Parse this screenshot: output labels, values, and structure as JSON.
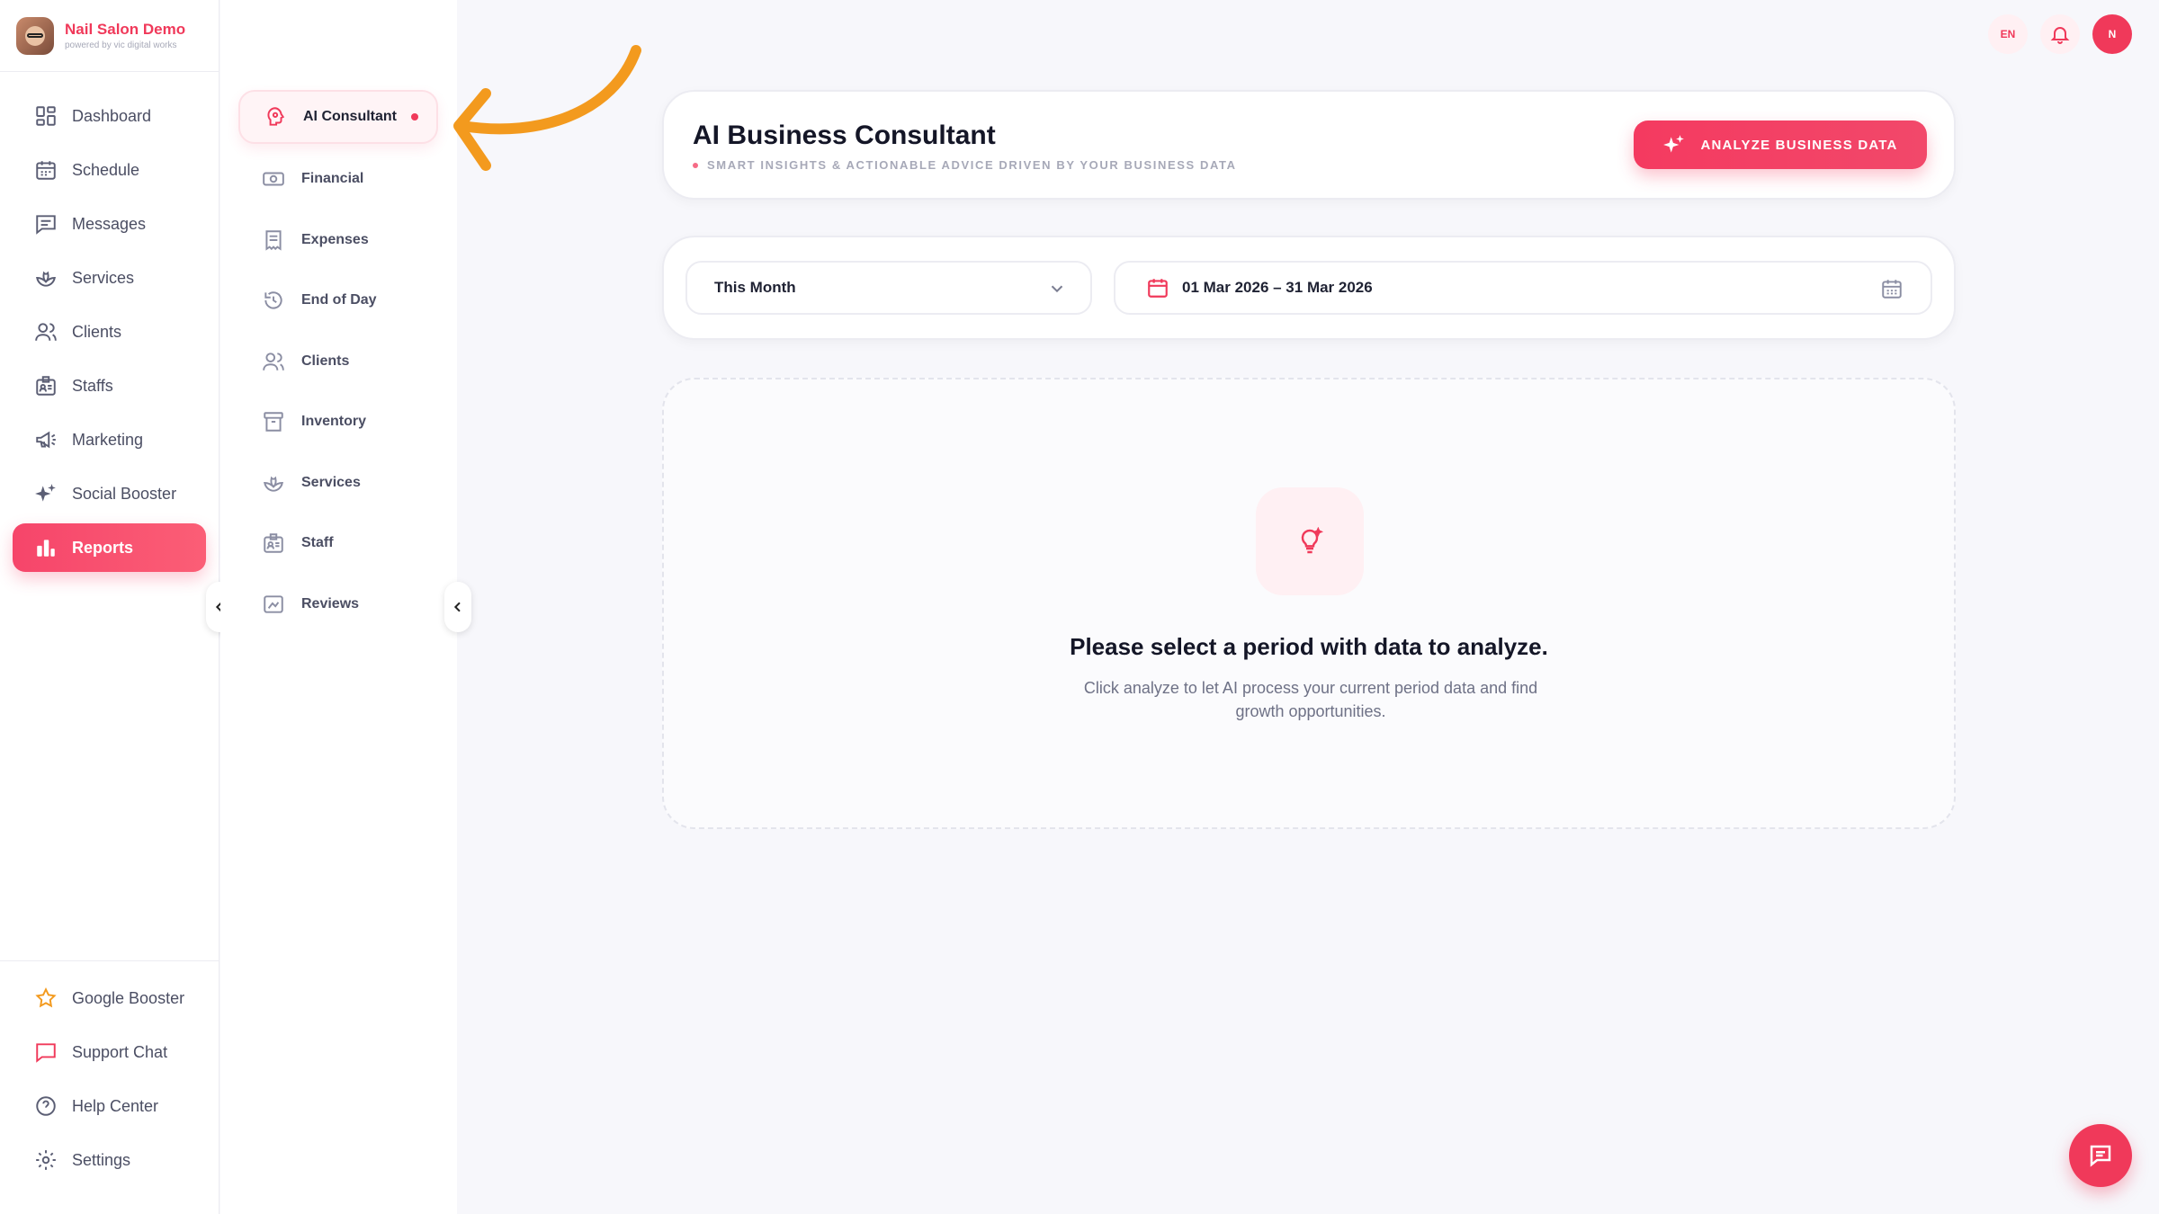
{
  "brand": {
    "name": "Nail Salon Demo",
    "sub": "powered by vic digital works"
  },
  "sidebar": {
    "items": [
      {
        "label": "Dashboard",
        "icon": "dashboard-icon"
      },
      {
        "label": "Schedule",
        "icon": "calendar-icon"
      },
      {
        "label": "Messages",
        "icon": "message-icon"
      },
      {
        "label": "Services",
        "icon": "lotus-icon"
      },
      {
        "label": "Clients",
        "icon": "users-icon"
      },
      {
        "label": "Staffs",
        "icon": "id-badge-icon"
      },
      {
        "label": "Marketing",
        "icon": "megaphone-icon"
      },
      {
        "label": "Social Booster",
        "icon": "sparkles-icon"
      },
      {
        "label": "Reports",
        "icon": "bar-chart-icon",
        "active": true
      }
    ],
    "bottom": [
      {
        "label": "Google Booster",
        "icon": "star-icon"
      },
      {
        "label": "Support Chat",
        "icon": "chat-bubble-icon"
      },
      {
        "label": "Help Center",
        "icon": "help-circle-icon"
      },
      {
        "label": "Settings",
        "icon": "gear-icon"
      }
    ]
  },
  "reports_menu": {
    "items": [
      {
        "label": "AI Consultant",
        "active": true
      },
      {
        "label": "Financial"
      },
      {
        "label": "Expenses"
      },
      {
        "label": "End of Day"
      },
      {
        "label": "Clients"
      },
      {
        "label": "Inventory"
      },
      {
        "label": "Services"
      },
      {
        "label": "Staff"
      },
      {
        "label": "Reviews"
      }
    ]
  },
  "topbar": {
    "language": "EN",
    "user_initial": "N"
  },
  "consultant": {
    "title": "AI Business Consultant",
    "subtitle": "SMART INSIGHTS & ACTIONABLE ADVICE DRIVEN BY YOUR BUSINESS DATA",
    "analyze_label": "ANALYZE BUSINESS DATA"
  },
  "filters": {
    "period": "This Month",
    "date_range": "01 Mar 2026 – 31 Mar 2026"
  },
  "empty_state": {
    "title": "Please select a period with data to analyze.",
    "description": "Click analyze to let AI process your current period data and find growth opportunities."
  },
  "colors": {
    "accent": "#f0395a",
    "annotation_arrow": "#f39a1e",
    "background": "#f7f7fb"
  }
}
